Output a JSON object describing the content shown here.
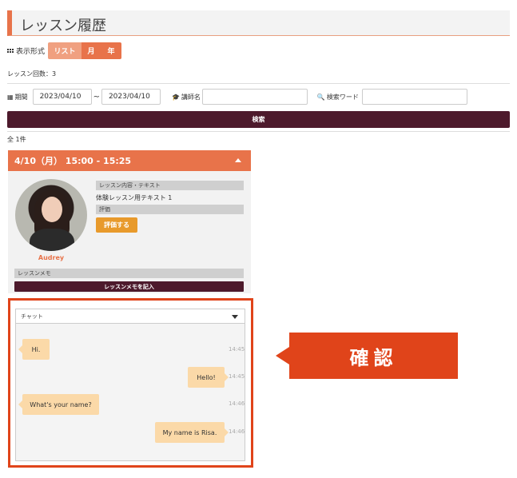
{
  "page": {
    "title": "レッスン履歴"
  },
  "display": {
    "label": "表示形式",
    "options": [
      "リスト",
      "月",
      "年"
    ]
  },
  "lesson_count": "レッスン回数：3",
  "filters": {
    "period_label": "期間",
    "date_from": "2023/04/10",
    "separator": "~",
    "date_to": "2023/04/10",
    "teacher_label": "講師名",
    "teacher_value": "",
    "keyword_label": "検索ワード",
    "keyword_value": ""
  },
  "search_button": "検索",
  "total": "全 1件",
  "lesson": {
    "datetime": "4/10（月） 15:00 - 15:25",
    "tutor_name": "Audrey",
    "content_label": "レッスン内容・テキスト",
    "content_value": "体験レッスン用テキスト 1",
    "rating_label": "評価",
    "rate_button": "評価する",
    "memo_label": "レッスンメモ",
    "memo_button": "レッスンメモを記入"
  },
  "chat": {
    "selector_label": "チャット",
    "messages": [
      {
        "side": "left",
        "text": "Hi.",
        "time": "14:45"
      },
      {
        "side": "right",
        "text": "Hello!",
        "time": "14:45"
      },
      {
        "side": "left",
        "text": "What's your name?",
        "time": "14:46"
      },
      {
        "side": "right",
        "text": "My name is Risa.",
        "time": "14:46"
      }
    ]
  },
  "callout": {
    "text": "確認"
  },
  "colors": {
    "accent": "#e8734a",
    "dark": "#4d1a2c",
    "highlight": "#e0441a",
    "bubble": "#fbd9a8"
  }
}
